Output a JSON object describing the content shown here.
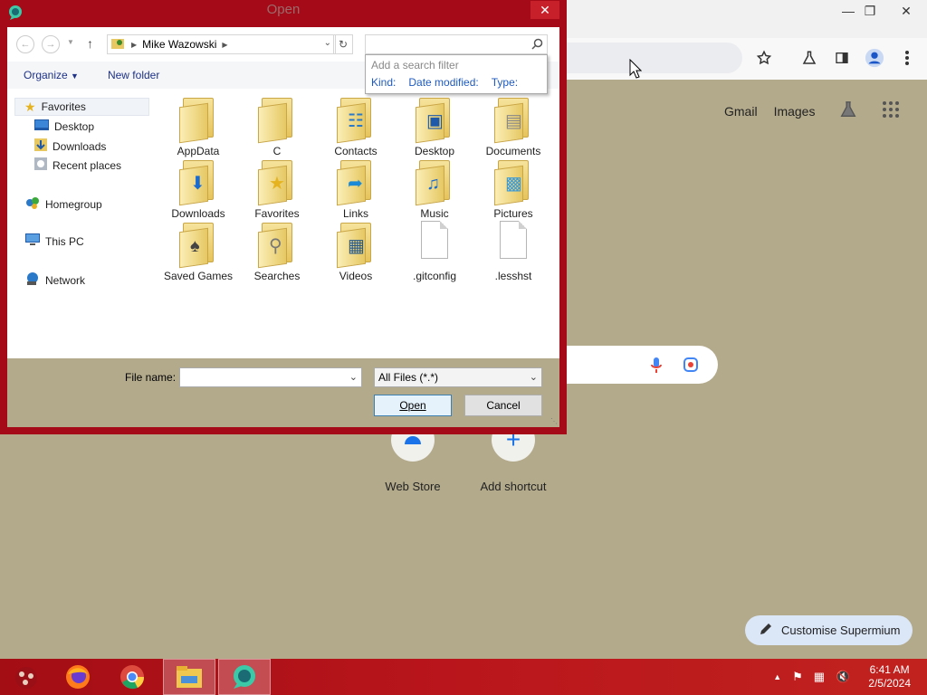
{
  "dialog": {
    "title": "Open",
    "address": "Mike Wazowski",
    "search_placeholder": "",
    "search_popup": {
      "title": "Add a search filter",
      "filters": [
        "Kind:",
        "Date modified:",
        "Type:"
      ]
    },
    "toolbar": {
      "organize": "Organize",
      "new_folder": "New folder"
    },
    "nav": {
      "favorites": "Favorites",
      "desktop": "Desktop",
      "downloads": "Downloads",
      "recent": "Recent places",
      "homegroup": "Homegroup",
      "thispc": "This PC",
      "network": "Network"
    },
    "files": [
      {
        "name": "AppData",
        "icon": "folder"
      },
      {
        "name": "C",
        "icon": "folder"
      },
      {
        "name": "Contacts",
        "icon": "folder-contacts"
      },
      {
        "name": "Desktop",
        "icon": "folder-desktop"
      },
      {
        "name": "Documents",
        "icon": "folder-documents"
      },
      {
        "name": "Downloads",
        "icon": "folder-downloads"
      },
      {
        "name": "Favorites",
        "icon": "folder-favorites"
      },
      {
        "name": "Links",
        "icon": "folder-links"
      },
      {
        "name": "Music",
        "icon": "folder-music"
      },
      {
        "name": "Pictures",
        "icon": "folder-pictures"
      },
      {
        "name": "Saved Games",
        "icon": "folder-saved-games"
      },
      {
        "name": "Searches",
        "icon": "folder-searches"
      },
      {
        "name": "Videos",
        "icon": "folder-videos"
      },
      {
        "name": ".gitconfig",
        "icon": "file"
      },
      {
        "name": ".lesshst",
        "icon": "file"
      }
    ],
    "filename_label": "File name:",
    "filename_value": "",
    "filetype": "All Files (*.*)",
    "open_label": "Open",
    "cancel_label": "Cancel"
  },
  "browser": {
    "gmail": "Gmail",
    "images": "Images",
    "shortcuts": [
      {
        "label": "Web Store",
        "icon": "web-store-icon"
      },
      {
        "label": "Add shortcut",
        "icon": "plus-icon"
      }
    ],
    "customise": "Customise Supermium"
  },
  "taskbar": {
    "time": "6:41 AM",
    "date": "2/5/2024"
  }
}
